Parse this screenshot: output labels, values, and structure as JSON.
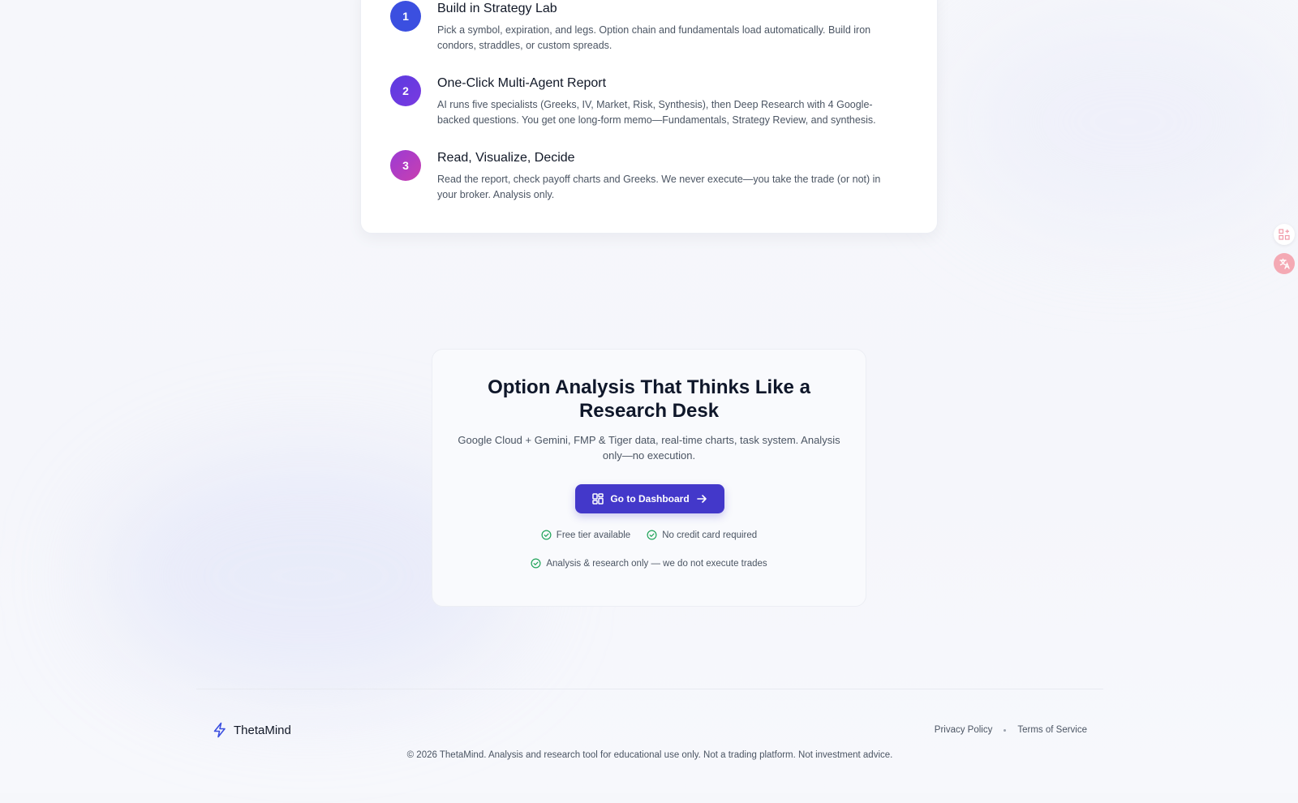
{
  "colors": {
    "step1": "#3b4fe0",
    "step2": "#6d3ae0",
    "step3": "#b23ec4",
    "primary_button": "#4338ca",
    "check": "#22a55b",
    "brand_icon": "#3b4fe0"
  },
  "steps": [
    {
      "number": "1",
      "title": "Build in Strategy Lab",
      "description": "Pick a symbol, expiration, and legs. Option chain and fundamentals load automatically. Build iron condors, straddles, or custom spreads."
    },
    {
      "number": "2",
      "title": "One-Click Multi-Agent Report",
      "description": "AI runs five specialists (Greeks, IV, Market, Risk, Synthesis), then Deep Research with 4 Google-backed questions. You get one long-form memo—Fundamentals, Strategy Review, and synthesis."
    },
    {
      "number": "3",
      "title": "Read, Visualize, Decide",
      "description": "Read the report, check payoff charts and Greeks. We never execute—you take the trade (or not) in your broker. Analysis only."
    }
  ],
  "cta": {
    "title": "Option Analysis That Thinks Like a Research Desk",
    "subtitle": "Google Cloud + Gemini, FMP & Tiger data, real-time charts, task system. Analysis only—no execution.",
    "button_label": "Go to Dashboard",
    "button_icon": "dashboard-grid-icon",
    "features": [
      "Free tier available",
      "No credit card required",
      "Analysis & research only — we do not execute trades"
    ]
  },
  "footer": {
    "brand": "ThetaMind",
    "brand_icon": "lightning-bolt-icon",
    "links": [
      "Privacy Policy",
      "Terms of Service"
    ],
    "copyright": "© 2026 ThetaMind. Analysis and research tool for educational use only. Not a trading platform. Not investment advice."
  }
}
